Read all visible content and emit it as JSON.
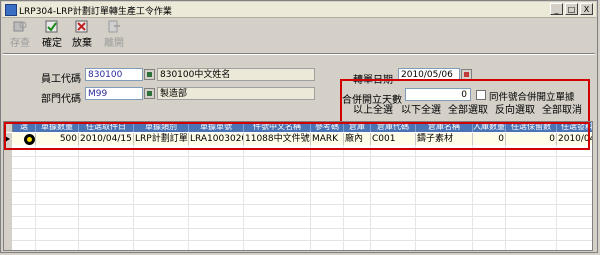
{
  "window": {
    "title": "LRP304-LRP計劃訂單轉生產工令作業"
  },
  "titlebar_buttons": [
    "_",
    "□",
    "X"
  ],
  "toolbar": {
    "items": [
      {
        "label": "存查",
        "icon": "query-icon",
        "enabled": false
      },
      {
        "label": "確定",
        "icon": "confirm-icon",
        "enabled": true
      },
      {
        "label": "放棄",
        "icon": "discard-icon",
        "enabled": true
      },
      {
        "label": "離開",
        "icon": "exit-icon",
        "enabled": false
      }
    ]
  },
  "form": {
    "employee_label": "員工代碼",
    "employee_code": "830100",
    "employee_name": "830100中文姓名",
    "dept_label": "部門代碼",
    "dept_code": "M99",
    "dept_name": "製造部",
    "date_label": "轉單日期",
    "date_value": "2010/05/06",
    "merge_days_label": "合併開立天數",
    "merge_days_value": "0",
    "same_part_label": "同件號合併開立單據"
  },
  "actions": {
    "select_above": "以上全選",
    "select_below": "以下全選",
    "select_all": "全部選取",
    "invert": "反向選取",
    "cancel_all": "全部取消"
  },
  "grid": {
    "columns": [
      "選",
      "單據數量",
      "任選取件日",
      "單據類別",
      "單據單號",
      "件號中文名稱",
      "參考碼",
      "倉庫",
      "倉庫代碼",
      "倉庫名稱",
      "入庫數量",
      "任選保留數",
      "任選發料"
    ],
    "rows": [
      {
        "selected": true,
        "qty": "500",
        "date": "2010/04/15",
        "doc_type": "LRP計劃訂單",
        "doc_no": "LRA1003020",
        "part_name": "11088中文件號",
        "ref": "MARK",
        "wh": "廠內",
        "wh_code": "C001",
        "wh_name": "鑄子素材",
        "in_qty": "0",
        "reserve": "0",
        "issue": "2010/04"
      }
    ]
  },
  "colors": {
    "highlight_border": "#d10000",
    "header_bg": "#4a74b4"
  }
}
